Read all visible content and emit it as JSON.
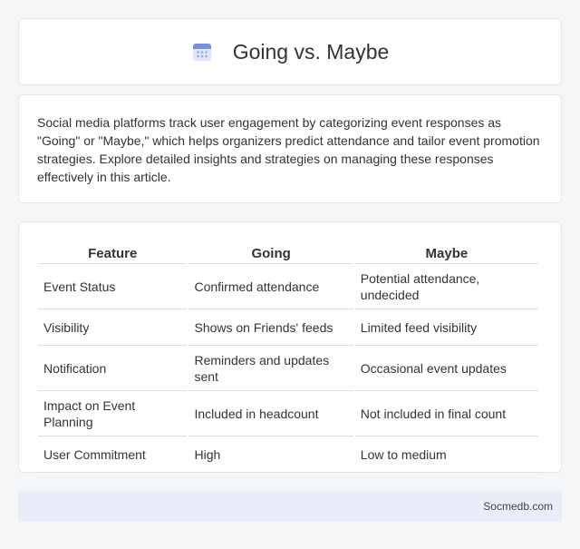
{
  "header": {
    "title": "Going vs. Maybe",
    "icon": "calendar-icon"
  },
  "intro": {
    "text": "Social media platforms track user engagement by categorizing event responses as \"Going\" or \"Maybe,\" which helps organizers predict attendance and tailor event promotion strategies. Explore detailed insights and strategies on managing these responses effectively in this article."
  },
  "table": {
    "headers": [
      "Feature",
      "Going",
      "Maybe"
    ],
    "rows": [
      [
        "Event Status",
        "Confirmed attendance",
        "Potential attendance, undecided"
      ],
      [
        "Visibility",
        "Shows on Friends' feeds",
        "Limited feed visibility"
      ],
      [
        "Notification",
        "Reminders and updates sent",
        "Occasional event updates"
      ],
      [
        "Impact on Event Planning",
        "Included in headcount",
        "Not included in final count"
      ],
      [
        "User Commitment",
        "High",
        "Low to medium"
      ]
    ]
  },
  "footer": {
    "text": "Socmedb.com"
  }
}
